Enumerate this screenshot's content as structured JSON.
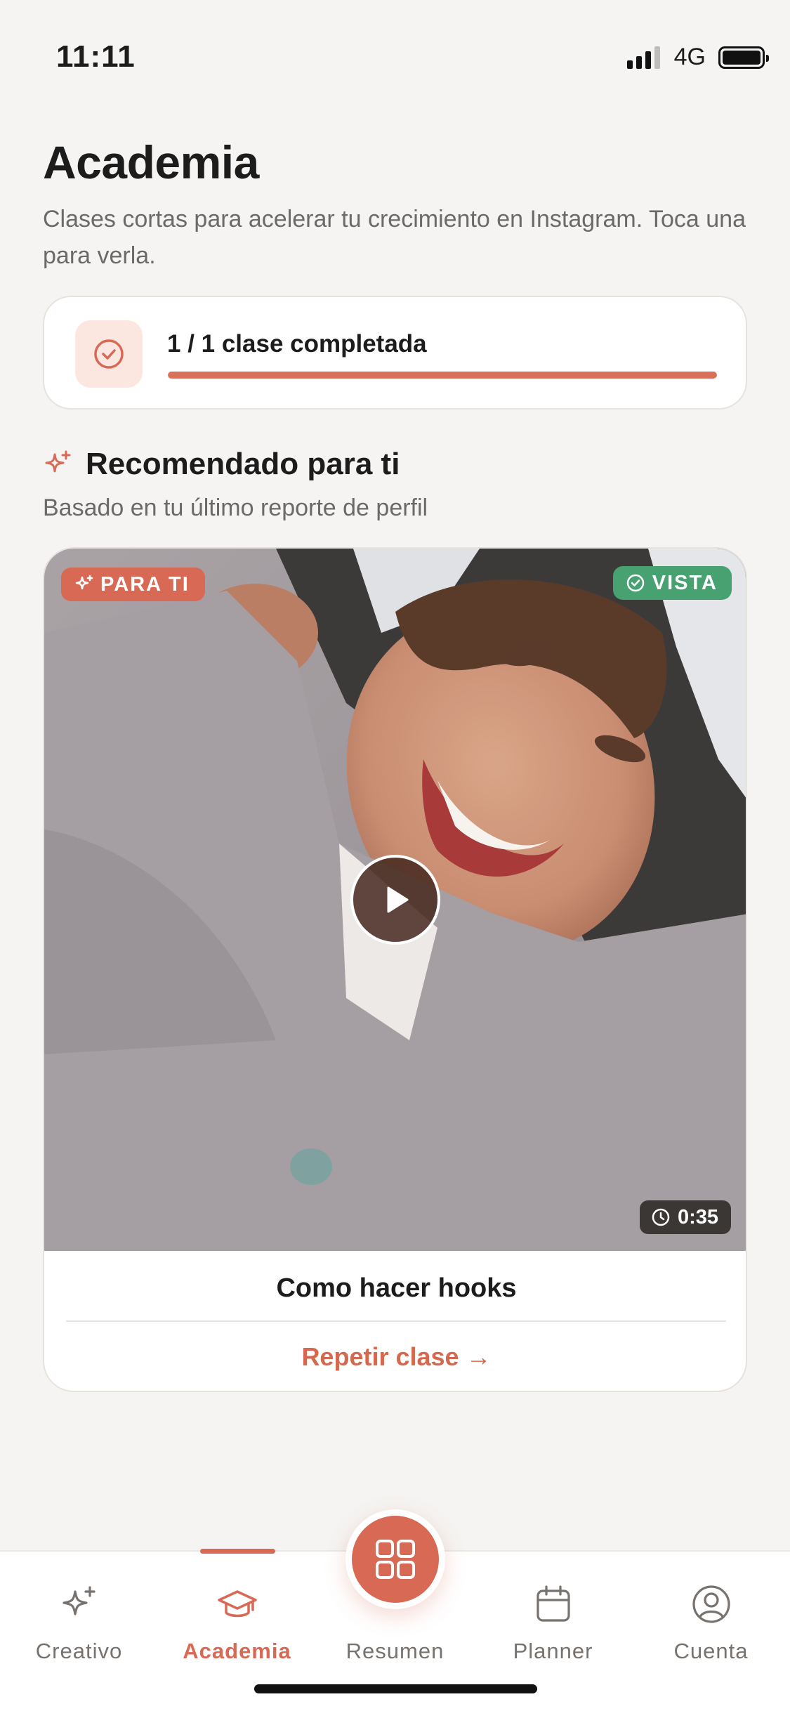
{
  "status_bar": {
    "time": "11:11",
    "network": "4G",
    "battery_level": 1.0,
    "signal_bars": 4
  },
  "header": {
    "title": "Academia",
    "subtitle": "Clases cortas para acelerar tu crecimiento en Instagram. Toca una para verla."
  },
  "progress": {
    "label": "1 / 1 clase completada",
    "completed": 1,
    "total": 1,
    "fraction": 1.0,
    "icon": "check-circle-icon"
  },
  "section": {
    "title": "Recomendado para ti",
    "subtitle": "Basado en tu último reporte de perfil",
    "icon": "sparkle-icon"
  },
  "lesson": {
    "badge_recommended": "PARA TI",
    "badge_status": "VISTA",
    "duration": "0:35",
    "title": "Como hacer hooks",
    "action_label": "Repetir clase →"
  },
  "tabs": [
    {
      "label": "Creativo",
      "icon": "sparkle-icon",
      "active": false
    },
    {
      "label": "Academia",
      "icon": "graduation-cap-icon",
      "active": true
    },
    {
      "label": "Resumen",
      "icon": "grid-icon",
      "active": false
    },
    {
      "label": "Planner",
      "icon": "calendar-icon",
      "active": false
    },
    {
      "label": "Cuenta",
      "icon": "user-circle-icon",
      "active": false
    }
  ],
  "colors": {
    "accent": "#d86a55",
    "success": "#47a170",
    "background": "#f5f4f2"
  }
}
